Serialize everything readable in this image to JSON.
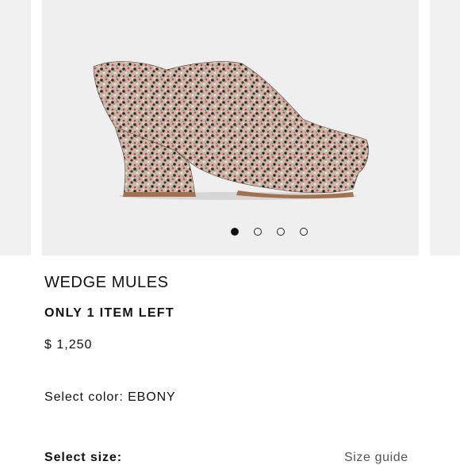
{
  "product": {
    "name": "WEDGE MULES",
    "stock_note": "ONLY 1 ITEM LEFT",
    "price": "$ 1,250"
  },
  "carousel": {
    "slide_count": 4,
    "active_index": 0,
    "image": "tweed-wedge-mule-shoe"
  },
  "color": {
    "label": "Select color:",
    "value": "EBONY",
    "display": "Select color: EBONY"
  },
  "size": {
    "label": "Select size:",
    "guide_link": "Size guide"
  },
  "colors": {
    "background": "#ffffff",
    "image_bg": "#efefef",
    "text": "#111111",
    "muted": "#555555"
  }
}
